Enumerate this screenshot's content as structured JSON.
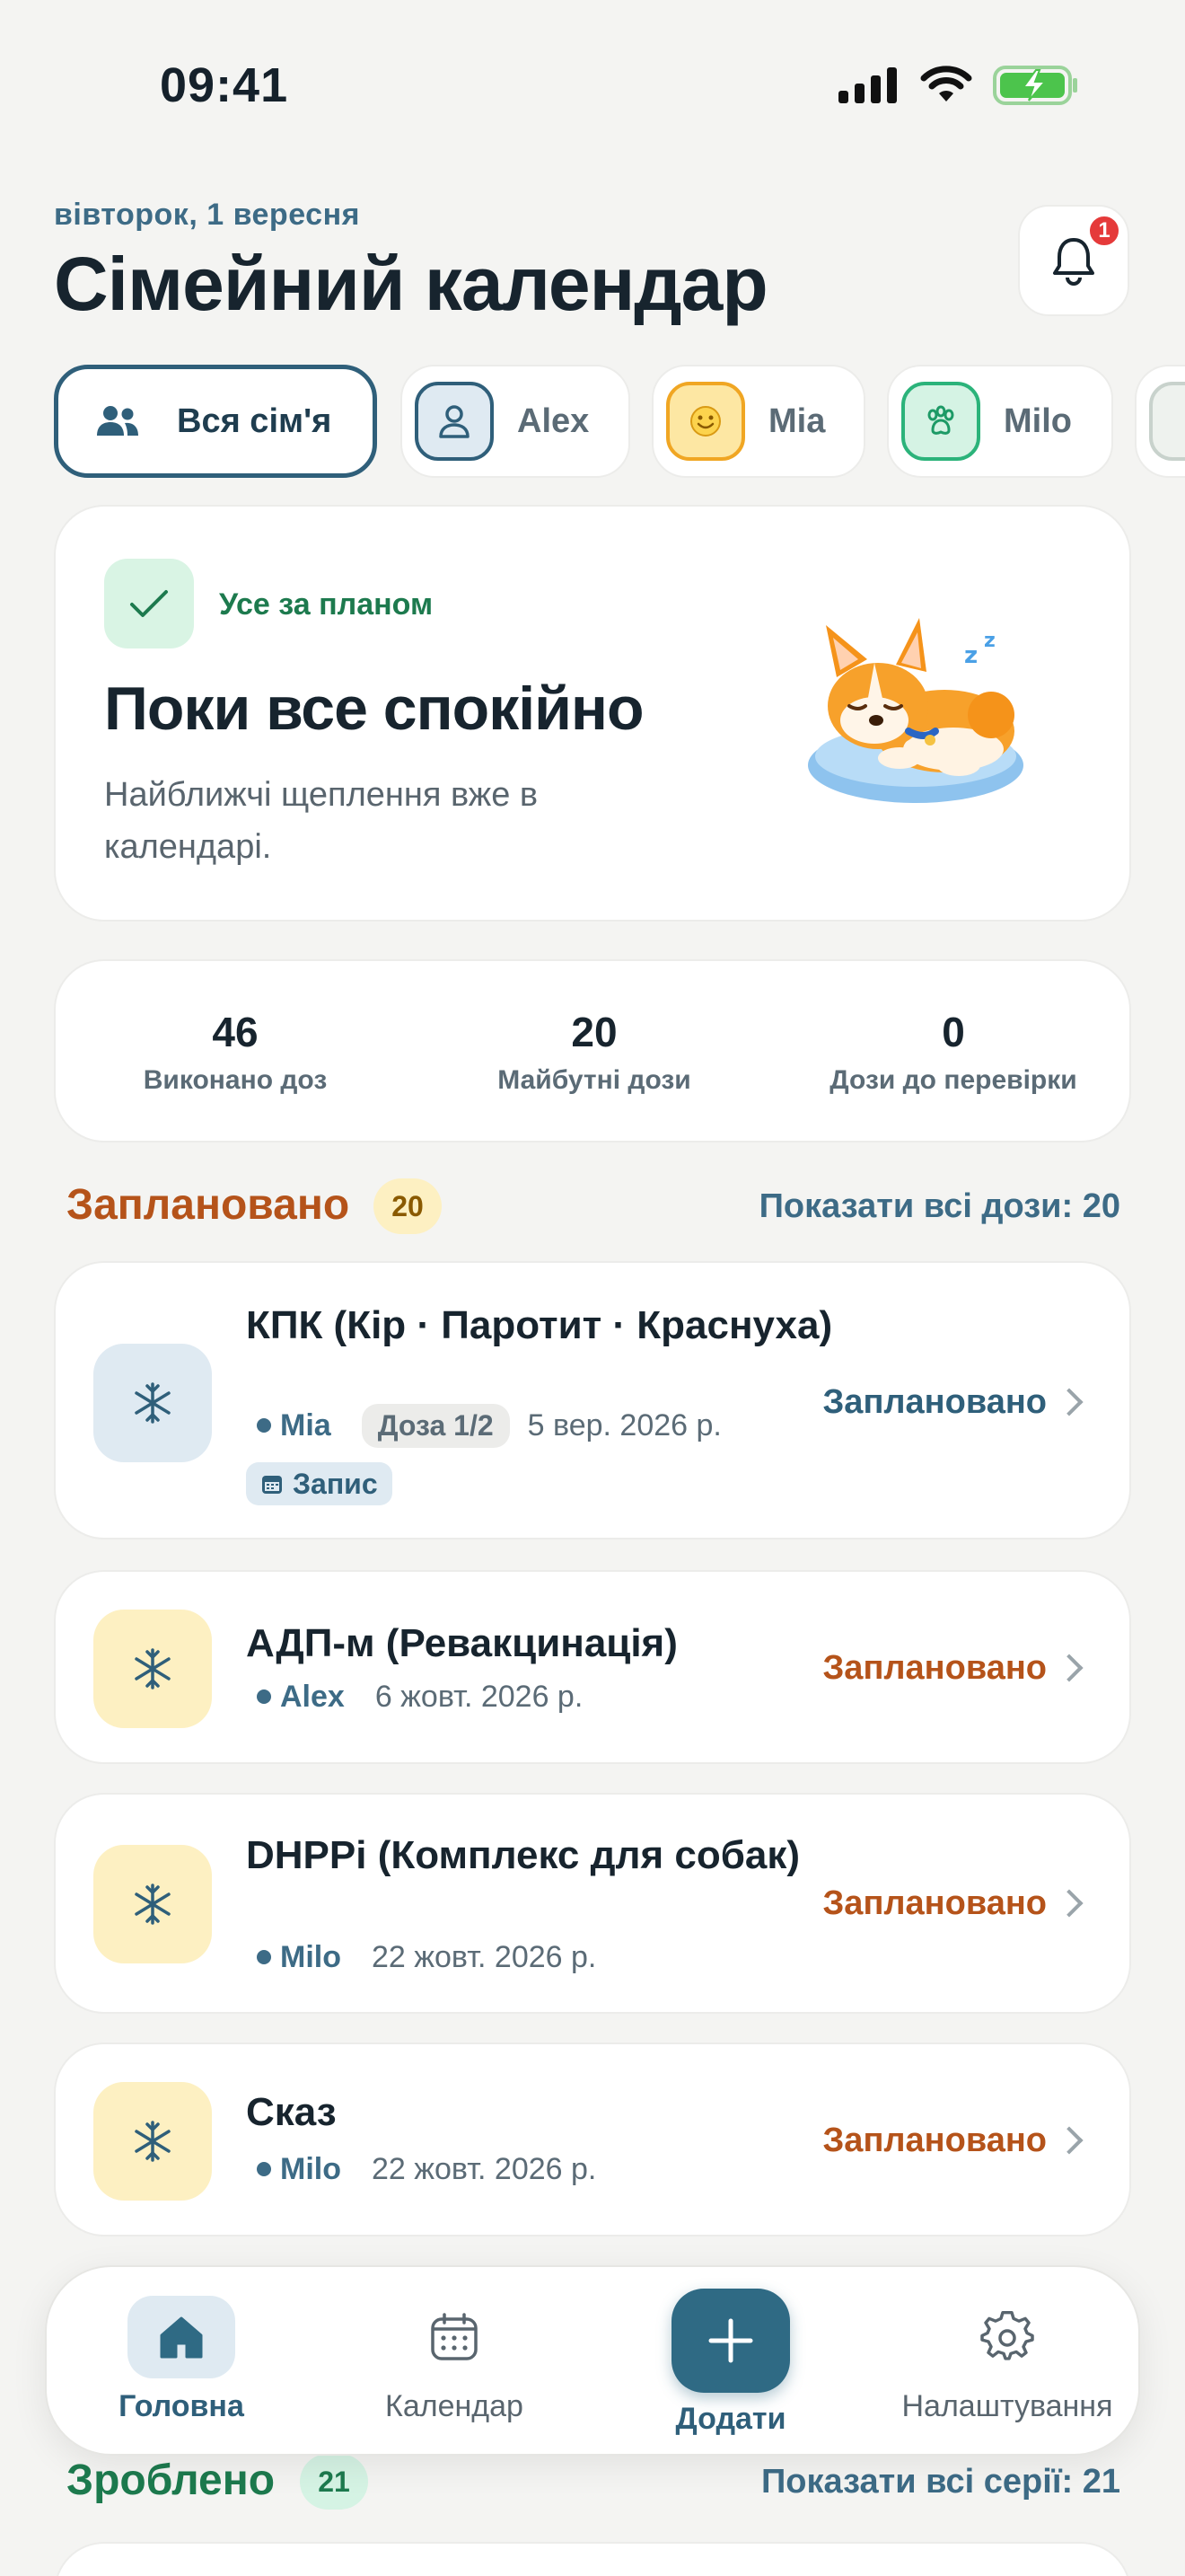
{
  "status_bar": {
    "time": "09:41"
  },
  "header": {
    "date": "вівторок, 1 вересня",
    "title": "Сімейний календар",
    "notifications_count": "1"
  },
  "members": [
    {
      "label": "Вся сім'я",
      "icon": "people-icon",
      "active": true
    },
    {
      "label": "Alex",
      "icon": "person-icon",
      "color": "#3d6b86"
    },
    {
      "label": "Mia",
      "icon": "smile-icon",
      "color": "#f0a623"
    },
    {
      "label": "Milo",
      "icon": "paw-icon",
      "color": "#2bb37a"
    }
  ],
  "hero": {
    "status": "Усе за планом",
    "title": "Поки все спокійно",
    "subtitle": "Найближчі щеплення вже в календарі.",
    "illustration": "sleeping-corgi"
  },
  "stats": [
    {
      "value": "46",
      "label": "Виконано доз"
    },
    {
      "value": "20",
      "label": "Майбутні дози"
    },
    {
      "value": "0",
      "label": "Дози до перевірки"
    }
  ],
  "planned": {
    "title": "Заплановано",
    "count": "20",
    "link": "Показати всі дози: 20",
    "items": [
      {
        "title": "КПК (Кір · Паротит · Краснуха)",
        "member": "Mia",
        "dose": "Доза 1/2",
        "date": "5 вер. 2026 р.",
        "appointment": "Запис",
        "status": "Заплановано",
        "icon_bg": "#dfeaf2",
        "status_color": "#2f5f7a"
      },
      {
        "title": "АДП-м (Ревакцинація)",
        "member": "Alex",
        "date": "6 жовт. 2026 р.",
        "status": "Заплановано",
        "icon_bg": "#fdf0c2",
        "status_color": "#b5531a"
      },
      {
        "title": "DHPPi (Комплекс для собак)",
        "member": "Milo",
        "date": "22 жовт. 2026 р.",
        "status": "Заплановано",
        "icon_bg": "#fdf0c2",
        "status_color": "#b5531a"
      },
      {
        "title": "Сказ",
        "member": "Milo",
        "date": "22 жовт. 2026 р.",
        "status": "Заплановано",
        "icon_bg": "#fdf0c2",
        "status_color": "#b5531a"
      }
    ]
  },
  "done": {
    "title": "Зроблено",
    "count": "21",
    "link": "Показати всі серії: 21"
  },
  "nav": {
    "home": "Головна",
    "calendar": "Календар",
    "add": "Додати",
    "settings": "Налаштування"
  },
  "colors": {
    "accent": "#2f6a84",
    "planned_orange": "#b5531a",
    "done_green": "#1d7a4e"
  }
}
